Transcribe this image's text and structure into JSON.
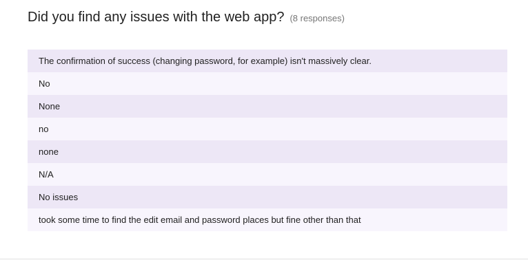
{
  "question": {
    "title": "Did you find any issues with the web app?",
    "response_count": "(8 responses)"
  },
  "responses": [
    "The confirmation of success (changing password, for example) isn't massively clear.",
    "No",
    "None",
    "no",
    "none",
    "N/A",
    "No issues",
    "took some time to find the edit email and password places but fine other than that"
  ],
  "colors": {
    "row_odd": "#ede7f6",
    "row_even": "#f8f5fd",
    "title_text": "#212121",
    "count_text": "#757575"
  }
}
